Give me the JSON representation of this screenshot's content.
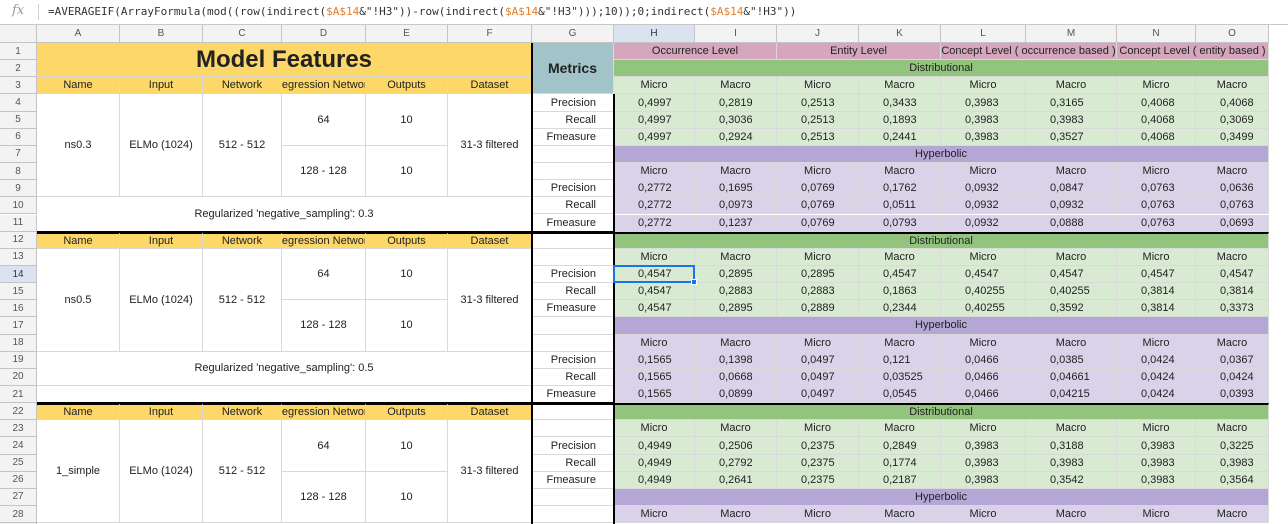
{
  "formula": {
    "icon": "fx",
    "segments": [
      {
        "t": "=AVERAGEIF(ArrayFormula(mod((row(indirect(",
        "ref": false
      },
      {
        "t": "$A$14",
        "ref": true
      },
      {
        "t": "&\"!H3\"))-row(indirect(",
        "ref": false
      },
      {
        "t": "$A$14",
        "ref": true
      },
      {
        "t": "&\"!H3\")));10));0;indirect(",
        "ref": false
      },
      {
        "t": "$A$14",
        "ref": true
      },
      {
        "t": "&\"!H3\"))",
        "ref": false
      }
    ]
  },
  "columns": [
    "A",
    "B",
    "C",
    "D",
    "E",
    "F",
    "G",
    "H",
    "I",
    "J",
    "K",
    "L",
    "M",
    "N",
    "O"
  ],
  "selected_cell": "H14",
  "colors": {
    "yellow": "#fdd868",
    "teal": "#a2c4c9",
    "pink": "#d5a6bd",
    "green_band": "#93c47d",
    "light_green": "#d9ead3",
    "purple_band": "#b4a7d6",
    "light_purple": "#d9d2e9",
    "selection": "#1a73e8"
  },
  "left": {
    "title": "Model Features",
    "headers": [
      "Name",
      "Input",
      "Network",
      "Regression Network",
      "Outputs",
      "Dataset"
    ],
    "blocks": [
      {
        "name": "ns0.3",
        "input": "ELMo (1024)",
        "network": "512 - 512",
        "reg1": "64",
        "reg2": "128 - 128",
        "out1": "10",
        "out2": "10",
        "dataset": "31-3 filtered",
        "note": "Regularized 'negative_sampling': 0.3"
      },
      {
        "name": "ns0.5",
        "input": "ELMo (1024)",
        "network": "512 - 512",
        "reg1": "64",
        "reg2": "128 - 128",
        "out1": "10",
        "out2": "10",
        "dataset": "31-3 filtered",
        "note": "Regularized 'negative_sampling': 0.5"
      },
      {
        "name": "1_simple",
        "input": "ELMo (1024)",
        "network": "512 - 512",
        "reg1": "64",
        "reg2": "128 - 128",
        "out1": "10",
        "out2": "10",
        "dataset": "31-3 filtered",
        "note": ""
      }
    ]
  },
  "right": {
    "metrics_title": "Metrics",
    "level_headers": [
      "Occurrence Level",
      "Entity Level",
      "Concept Level ( occurrence based )",
      "Concept Level ( entity based )"
    ],
    "distributional": "Distributional",
    "hyperbolic": "Hyperbolic",
    "sub_headers": [
      "Micro",
      "Macro",
      "Micro",
      "Macro",
      "Micro",
      "Macro",
      "Micro",
      "Macro"
    ],
    "metric_names": [
      "Precision",
      "Recall",
      "Fmeasure"
    ],
    "sections": [
      {
        "type": "distributional",
        "rows": [
          [
            "0,4997",
            "0,2819",
            "0,2513",
            "0,3433",
            "0,3983",
            "0,3165",
            "0,4068",
            "0,4068"
          ],
          [
            "0,4997",
            "0,3036",
            "0,2513",
            "0,1893",
            "0,3983",
            "0,3983",
            "0,4068",
            "0,3069"
          ],
          [
            "0,4997",
            "0,2924",
            "0,2513",
            "0,2441",
            "0,3983",
            "0,3527",
            "0,4068",
            "0,3499"
          ]
        ]
      },
      {
        "type": "hyperbolic",
        "rows": [
          [
            "0,2772",
            "0,1695",
            "0,0769",
            "0,1762",
            "0,0932",
            "0,0847",
            "0,0763",
            "0,0636"
          ],
          [
            "0,2772",
            "0,0973",
            "0,0769",
            "0,0511",
            "0,0932",
            "0,0932",
            "0,0763",
            "0,0763"
          ],
          [
            "0,2772",
            "0,1237",
            "0,0769",
            "0,0793",
            "0,0932",
            "0,0888",
            "0,0763",
            "0,0693"
          ]
        ]
      },
      {
        "type": "distributional",
        "rows": [
          [
            "0,4547",
            "0,2895",
            "0,2895",
            "0,4547",
            "0,4547",
            "0,4547",
            "0,4547",
            "0,4547"
          ],
          [
            "0,4547",
            "0,2883",
            "0,2883",
            "0,1863",
            "0,40255",
            "0,40255",
            "0,3814",
            "0,3814"
          ],
          [
            "0,4547",
            "0,2895",
            "0,2889",
            "0,2344",
            "0,40255",
            "0,3592",
            "0,3814",
            "0,3373"
          ]
        ]
      },
      {
        "type": "hyperbolic",
        "rows": [
          [
            "0,1565",
            "0,1398",
            "0,0497",
            "0,121",
            "0,0466",
            "0,0385",
            "0,0424",
            "0,0367"
          ],
          [
            "0,1565",
            "0,0668",
            "0,0497",
            "0,03525",
            "0,0466",
            "0,04661",
            "0,0424",
            "0,0424"
          ],
          [
            "0,1565",
            "0,0899",
            "0,0497",
            "0,0545",
            "0,0466",
            "0,04215",
            "0,0424",
            "0,0393"
          ]
        ]
      },
      {
        "type": "distributional",
        "rows": [
          [
            "0,4949",
            "0,2506",
            "0,2375",
            "0,2849",
            "0,3983",
            "0,3188",
            "0,3983",
            "0,3225"
          ],
          [
            "0,4949",
            "0,2792",
            "0,2375",
            "0,1774",
            "0,3983",
            "0,3983",
            "0,3983",
            "0,3983"
          ],
          [
            "0,4949",
            "0,2641",
            "0,2375",
            "0,2187",
            "0,3983",
            "0,3542",
            "0,3983",
            "0,3564"
          ]
        ]
      },
      {
        "type": "hyperbolic",
        "rows": []
      }
    ]
  }
}
